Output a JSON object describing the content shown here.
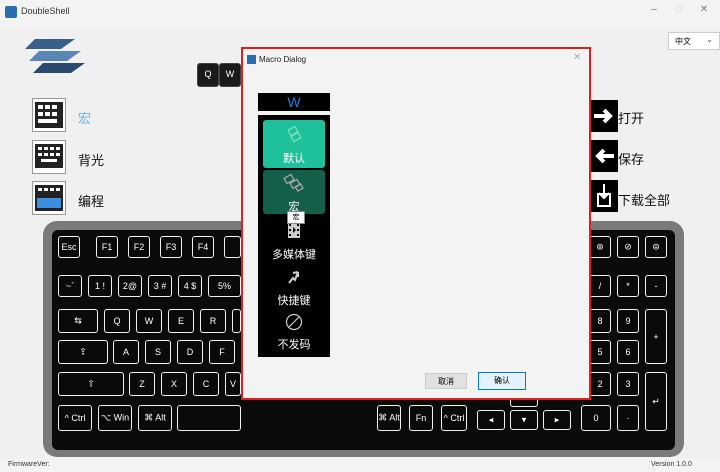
{
  "window": {
    "title": "DoubleShell",
    "minimize": "–",
    "maximize": "□",
    "close": "✕"
  },
  "language": {
    "value": "中文"
  },
  "left_menu": [
    {
      "label": "宏"
    },
    {
      "label": "背光"
    },
    {
      "label": "编程"
    }
  ],
  "right_menu": [
    {
      "label": "打开"
    },
    {
      "label": "保存"
    },
    {
      "label": "下载全部"
    }
  ],
  "top_keys": [
    "Q",
    "W"
  ],
  "keyboard": {
    "row1": [
      "Esc",
      "F1",
      "F2",
      "F3",
      "F4"
    ],
    "row1_right": [
      "⊛",
      "⊘",
      "⊜"
    ],
    "row2": [
      "~`",
      "1 !",
      "2@",
      "3 #",
      "4 $",
      "5%"
    ],
    "row3": [
      "⇆",
      "Q",
      "W",
      "E",
      "R"
    ],
    "row4": [
      "⇪",
      "A",
      "S",
      "D",
      "F"
    ],
    "row5": [
      "⇧",
      "Z",
      "X",
      "C",
      "V"
    ],
    "row6": [
      "^ Ctrl",
      "⌥ Win",
      "⌘ Alt"
    ],
    "row6_mid": [
      "⌘ Alt",
      "Fn",
      "^ Ctrl"
    ],
    "arrows": [
      "◂",
      "▾",
      "▸"
    ],
    "numpad": [
      [
        "/",
        "*",
        "-"
      ],
      [
        "8",
        "9",
        "+"
      ],
      [
        "5",
        "6",
        ""
      ],
      [
        "2",
        "3",
        "↵"
      ],
      [
        "0",
        "·",
        ""
      ]
    ]
  },
  "dialog": {
    "title": "Macro Dialog",
    "close": "✕",
    "selected_key": "W",
    "options": [
      {
        "label": "默认",
        "icon": "keys-icon"
      },
      {
        "label": "宏",
        "icon": "macro-keys-icon"
      },
      {
        "label": "多媒体键",
        "icon": "film-icon"
      },
      {
        "label": "快捷键",
        "icon": "shortcut-arrow-icon"
      },
      {
        "label": "不发码",
        "icon": "disabled-circle-icon"
      }
    ],
    "tooltip": "宏",
    "cancel": "取消",
    "confirm": "确认"
  },
  "status": {
    "firmware": "FirmwareVer:",
    "version": "Version 1.0.0"
  }
}
